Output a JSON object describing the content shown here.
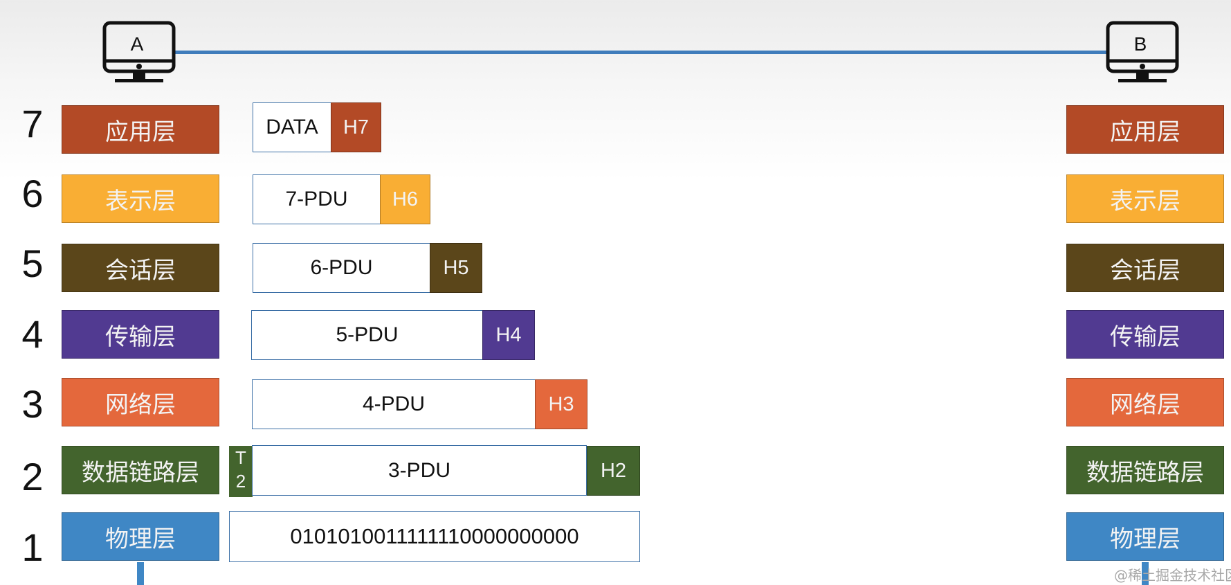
{
  "hosts": {
    "left": "A",
    "right": "B"
  },
  "layers": [
    {
      "num": "7",
      "name": "应用层",
      "color": "#b34a26"
    },
    {
      "num": "6",
      "name": "表示层",
      "color": "#f9ae34"
    },
    {
      "num": "5",
      "name": "会话层",
      "color": "#5b461a"
    },
    {
      "num": "4",
      "name": "传输层",
      "color": "#513a91"
    },
    {
      "num": "3",
      "name": "网络层",
      "color": "#e4683c"
    },
    {
      "num": "2",
      "name": "数据链路层",
      "color": "#43642d"
    },
    {
      "num": "1",
      "name": "物理层",
      "color": "#3f87c5"
    }
  ],
  "encapsulation": {
    "l7": {
      "payload": "DATA",
      "header": "H7"
    },
    "l6": {
      "payload": "7-PDU",
      "header": "H6"
    },
    "l5": {
      "payload": "6-PDU",
      "header": "H5"
    },
    "l4": {
      "payload": "5-PDU",
      "header": "H4"
    },
    "l3": {
      "payload": "4-PDU",
      "header": "H3"
    },
    "l2": {
      "payload": "3-PDU",
      "header": "H2",
      "trailer_top": "T",
      "trailer_bottom": "2"
    },
    "l1": {
      "bits": "0101010011111110000000000"
    }
  },
  "watermark": "@稀土掘金技术社区",
  "colors": {
    "link": "#3f7cbb",
    "pdu_border": "#3b6fa6"
  }
}
